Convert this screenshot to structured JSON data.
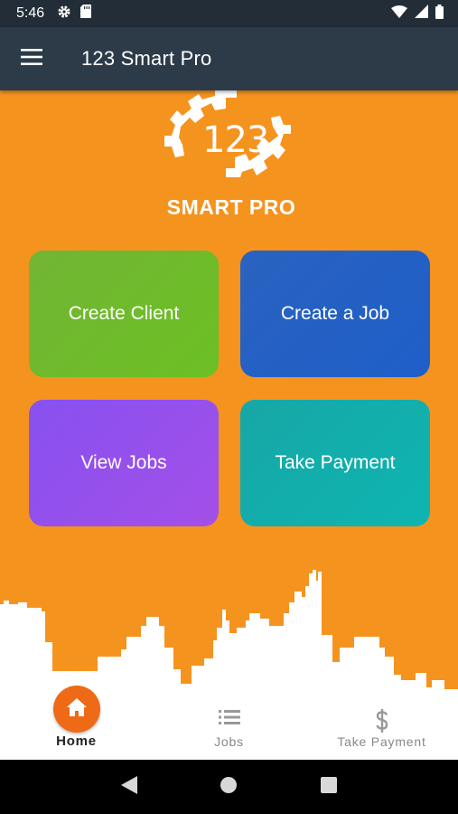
{
  "status_bar": {
    "time": "5:46",
    "icons_left": [
      "settings-icon",
      "sd-card-icon"
    ],
    "icons_right": [
      "wifi-icon",
      "signal-icon",
      "battery-icon"
    ]
  },
  "app_bar": {
    "title": "123 Smart Pro",
    "menu_icon": "hamburger-menu-icon"
  },
  "logo": {
    "number": "123",
    "text": "SMART PRO"
  },
  "tiles": [
    {
      "label": "Create Client",
      "color": "#6cbb2a"
    },
    {
      "label": "Create a Job",
      "color": "#2160c4"
    },
    {
      "label": "View Jobs",
      "color": "#9450ec"
    },
    {
      "label": "Take Payment",
      "color": "#13afac"
    }
  ],
  "bottom_nav": {
    "items": [
      {
        "label": "Home",
        "icon": "home-icon",
        "active": true
      },
      {
        "label": "Jobs",
        "icon": "list-icon",
        "active": false
      },
      {
        "label": "Take Payment",
        "icon": "dollar-icon",
        "active": false
      }
    ]
  },
  "colors": {
    "background": "#f5931f",
    "app_bar": "#2d3b49",
    "status_bar": "#222d38",
    "home_accent": "#ee6a17"
  },
  "system_nav": [
    "back-icon",
    "home-circle-icon",
    "recents-icon"
  ]
}
